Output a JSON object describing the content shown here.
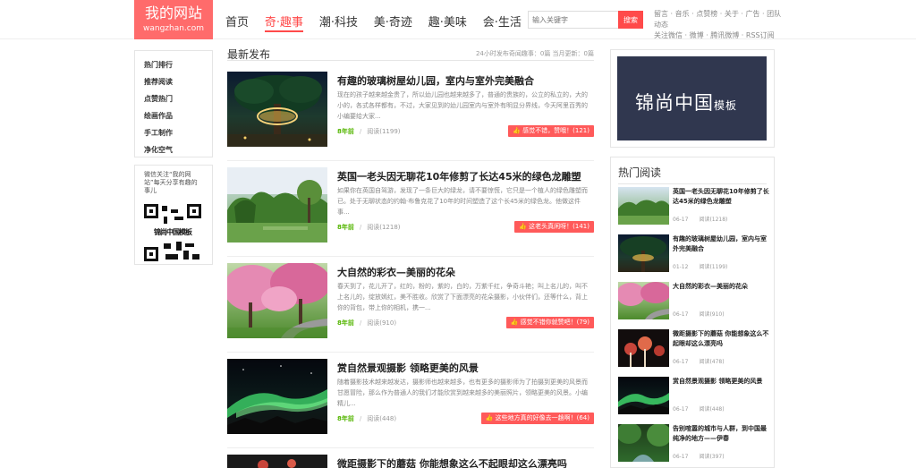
{
  "logo": {
    "title": "我的网站",
    "domain": "wangzhan.com"
  },
  "nav": [
    "首页",
    "奇·趣事",
    "潮·科技",
    "美·奇迹",
    "趣·美味",
    "会·生活"
  ],
  "search": {
    "placeholder": "输入关键字",
    "button": "搜索"
  },
  "toplinks": {
    "line1": "留言 · 音乐 · 点赞榜 · 关于 · 广告 · 团队动态",
    "line2": "关注微信 · 微博 · 腾讯微博 · RSS订阅"
  },
  "left_menu": [
    "热门排行",
    "推荐阅读",
    "点赞热门",
    "绘画作品",
    "手工制作",
    "净化空气"
  ],
  "qr": {
    "text": "微信关注“我的网站”每天分享有趣的事儿",
    "qr_label": "锦尚中国模板"
  },
  "main": {
    "title": "最新发布",
    "info": "24小时发布奇闻趣事：0篇 当月更新：0篇",
    "articles": [
      {
        "title": "有趣的玻璃树屋幼儿园，室内与室外完美融合",
        "desc": "现在的孩子越来越金贵了，所以幼儿园也越来越多了，普通的贵族的，公立的私立的，大的小的，各式各样都有，不过，大家见到的幼儿园室内与室外有明显分界线，今天阿里百秀的小编要给大家...",
        "time": "8年前",
        "views": "阅读(1199)",
        "like": "感觉不错，赞哦！(121)"
      },
      {
        "title": "英国一老头因无聊花10年修剪了长达45米的绿色龙雕塑",
        "desc": "如果你在英国自驾游，发现了一条巨大的绿龙，请不要惊慌，它只是一个植人的绿色雕塑而已。处于无聊状态的约翰·布鲁克花了10年的时间塑造了这个长45米的绿色龙。他做这件事...",
        "time": "8年前",
        "views": "阅读(1218)",
        "like": "这老头真闲呀！(141)"
      },
      {
        "title": "大自然的彩衣—美丽的花朵",
        "desc": "春天到了，花儿开了，红的，粉的，紫的，白的，万紫千红，争奇斗艳；叫上名儿的，叫不上名儿的，绽放嫣红，美不胜收。欣赏了下面漂亮的花朵摄影，小伙伴们，还等什么，背上你的背包，带上你的相机，携一...",
        "time": "8年前",
        "views": "阅读(910)",
        "like": "感觉不错你就赞吧！(79)"
      },
      {
        "title": "赏自然景观摄影 领略更美的风景",
        "desc": "随着摄影技术越来越发达，摄影师也越来越多，也有更多的摄影师为了拍摄到更美的风景而甘愿冒险，那么作为普通人的我们才能欣赏到越来越多的美丽照片，领略更美的风景。小编精儿...",
        "time": "8年前",
        "views": "阅读(448)",
        "like": "这些地方真的好像去一趟啊！(64)"
      },
      {
        "title": "微距摄影下的蘑菇 你能想象这么不起眼却这么漂亮吗",
        "desc": "",
        "time": "",
        "views": "",
        "like": ""
      }
    ]
  },
  "right": {
    "banner": {
      "big": "锦尚中国",
      "small": "模板"
    },
    "hot_title": "热门阅读",
    "hot": [
      {
        "title": "英国一老头因无聊花10年修剪了长达45米的绿色龙雕塑",
        "date": "06-17",
        "views": "阅读(1218)"
      },
      {
        "title": "有趣的玻璃树屋幼儿园，室内与室外完美融合",
        "date": "01-12",
        "views": "阅读(1199)"
      },
      {
        "title": "大自然的彩衣—美丽的花朵",
        "date": "06-17",
        "views": "阅读(910)"
      },
      {
        "title": "微距摄影下的蘑菇 你能想象这么不起眼却这么漂亮吗",
        "date": "06-17",
        "views": "阅读(478)"
      },
      {
        "title": "赏自然景观摄影 领略更美的风景",
        "date": "06-17",
        "views": "阅读(448)"
      },
      {
        "title": "告别喧嚣的城市与人群，到中国最纯净的地方——伊春",
        "date": "06-17",
        "views": "阅读(397)"
      }
    ]
  },
  "colors": {
    "accent": "#ff4a4a",
    "logo_bg": "#ff6b6b",
    "time_green": "#53b500",
    "banner_bg": "#30374f"
  }
}
